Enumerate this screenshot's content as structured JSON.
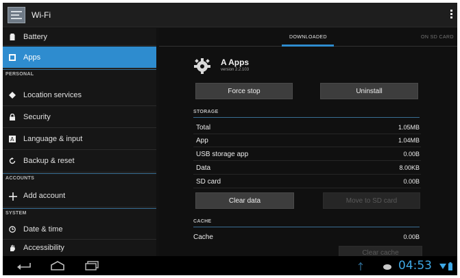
{
  "window": {
    "title": "Wi-Fi"
  },
  "sidebar": {
    "items": [
      {
        "label": "Battery",
        "icon": "battery-icon"
      },
      {
        "label": "Apps",
        "icon": "apps-icon",
        "active": true
      },
      {
        "label": "Location services",
        "icon": "location-icon"
      },
      {
        "label": "Security",
        "icon": "lock-icon"
      },
      {
        "label": "Language & input",
        "icon": "keyboard-icon"
      },
      {
        "label": "Backup & reset",
        "icon": "backup-icon"
      },
      {
        "label": "Add account",
        "icon": "plus-icon"
      },
      {
        "label": "Date & time",
        "icon": "clock-icon"
      },
      {
        "label": "Accessibility",
        "icon": "hand-icon"
      }
    ],
    "headers": {
      "personal": "PERSONAL",
      "accounts": "ACCOUNTS",
      "system": "SYSTEM"
    }
  },
  "tabs": {
    "downloaded": "DOWNLOADED",
    "on_sd": "ON SD CARD"
  },
  "app": {
    "name": "A Apps",
    "version": "version 2.2.103"
  },
  "buttons": {
    "force_stop": "Force stop",
    "uninstall": "Uninstall",
    "clear_data": "Clear data",
    "move_to_sd": "Move to SD card",
    "clear_cache": "Clear cache"
  },
  "storage": {
    "header": "STORAGE",
    "rows": [
      {
        "label": "Total",
        "value": "1.05MB"
      },
      {
        "label": "App",
        "value": "1.04MB"
      },
      {
        "label": "USB storage app",
        "value": "0.00B"
      },
      {
        "label": "Data",
        "value": "8.00KB"
      },
      {
        "label": "SD card",
        "value": "0.00B"
      }
    ]
  },
  "cache": {
    "header": "CACHE",
    "label": "Cache",
    "value": "0.00B"
  },
  "status": {
    "time": "04:53"
  },
  "colors": {
    "accent": "#2e8ccf",
    "clock": "#3fa9e6"
  }
}
